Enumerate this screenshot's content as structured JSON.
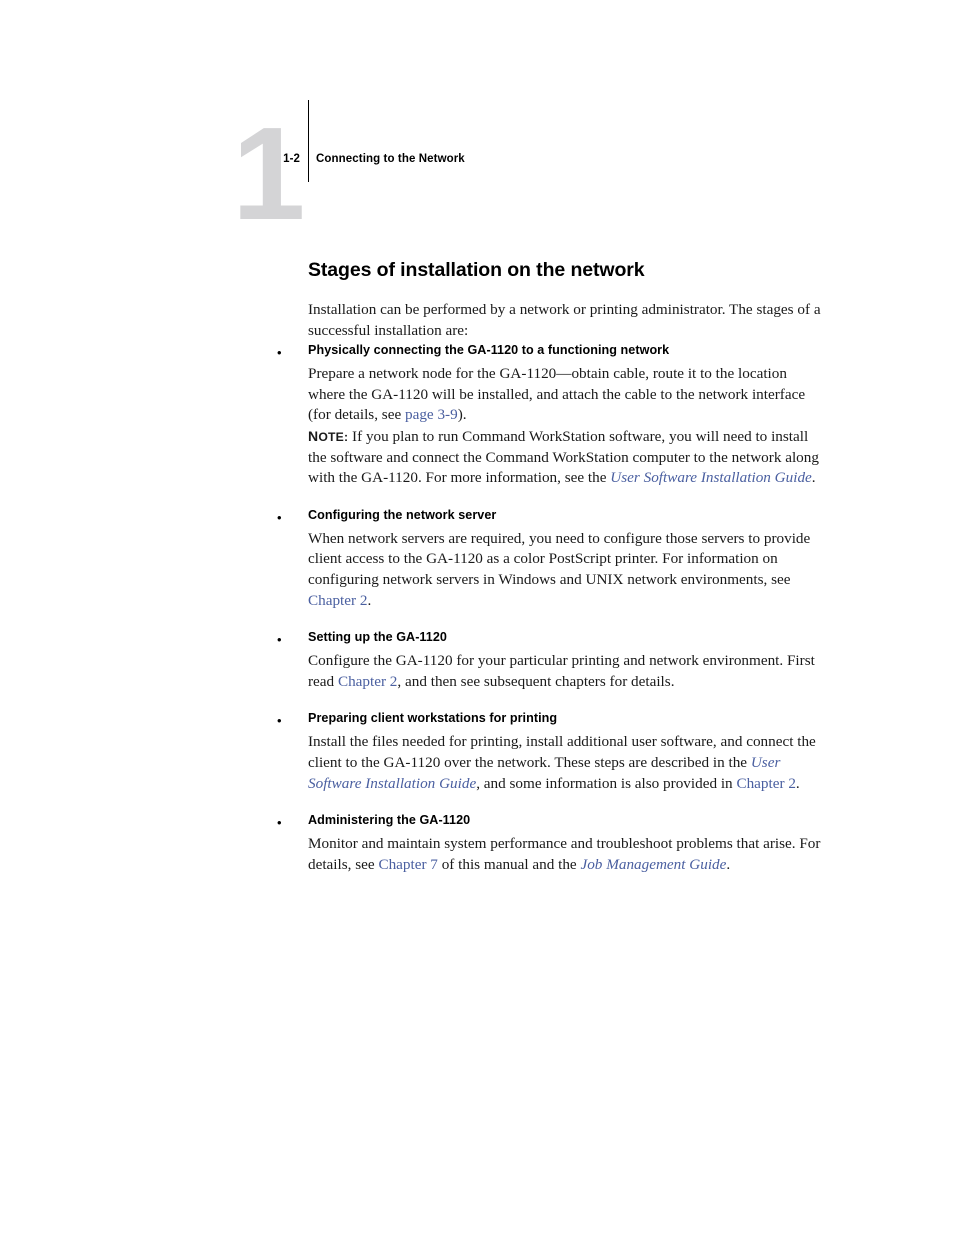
{
  "page": {
    "chapter_number": "1",
    "folio": "1-2",
    "running_head": "Connecting to the Network",
    "colors": {
      "chapter_number": "#d4d4d6",
      "link": "#4a5fa0",
      "text": "#1a1a1a"
    }
  },
  "section": {
    "title": "Stages of installation on the network",
    "intro": "Installation can be performed by a network or printing administrator. The stages of a successful installation are:"
  },
  "bullets": [
    {
      "marker": "•",
      "heading": "Physically connecting the GA-1120 to a functioning network",
      "body_part_1": "Prepare a network node for the GA-1120—obtain cable, route it to the location where the GA-1120 will be installed, and attach the cable to the network interface (for details, see ",
      "link_1": "page 3-9",
      "body_part_2": ").",
      "note": {
        "label_cap": "N",
        "label_rest": "OTE:",
        "text_part_1": " If you plan to run Command WorkStation software, you will need to install the software and connect the Command WorkStation computer to the network along with the GA-1120. For more information, see the ",
        "link_1": "User Software Installation Guide",
        "text_part_2": "."
      }
    },
    {
      "marker": "•",
      "heading": "Configuring the network server",
      "body_part_1": "When network servers are required, you need to configure those servers to provide client access to the GA-1120 as a color PostScript printer. For information on configuring network servers in Windows and UNIX network environments, see ",
      "link_1": "Chapter 2",
      "body_part_2": "."
    },
    {
      "marker": "•",
      "heading": "Setting up the GA-1120",
      "body_part_1": "Configure the GA-1120 for your particular printing and network environment. First read ",
      "link_1": "Chapter 2",
      "body_part_2": ", and then see subsequent chapters for details."
    },
    {
      "marker": "•",
      "heading": "Preparing client workstations for printing",
      "body_part_1": "Install the files needed for printing, install additional user software, and connect the client to the GA-1120 over the network. These steps are described in the ",
      "link_1": "User Software Installation Guide",
      "body_part_2": ", and some information is also provided in ",
      "link_2": "Chapter 2",
      "body_part_3": "."
    },
    {
      "marker": "•",
      "heading": "Administering the GA-1120",
      "body_part_1": "Monitor and maintain system performance and troubleshoot problems that arise. For details, see ",
      "link_1": "Chapter 7",
      "body_part_2": " of this manual and the ",
      "link_2": "Job Management Guide",
      "body_part_3": "."
    }
  ]
}
